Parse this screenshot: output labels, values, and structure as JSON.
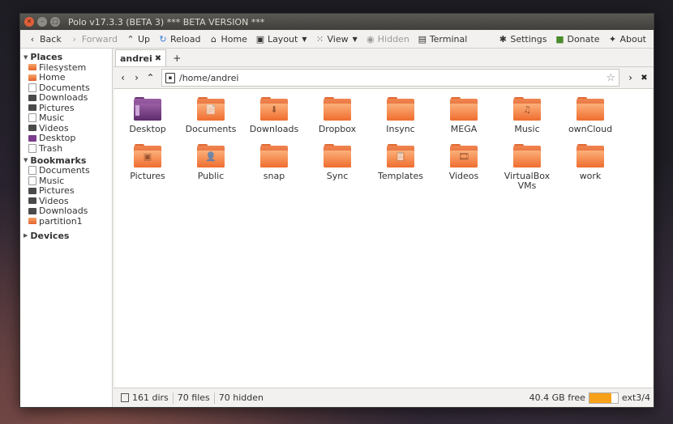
{
  "window": {
    "title": "Polo v17.3.3 (BETA 3)  *** BETA VERSION ***"
  },
  "toolbar": {
    "back": "Back",
    "forward": "Forward",
    "up": "Up",
    "reload": "Reload",
    "home": "Home",
    "layout": "Layout",
    "view": "View",
    "hidden": "Hidden",
    "terminal": "Terminal",
    "settings": "Settings",
    "donate": "Donate",
    "about": "About"
  },
  "sidebar": {
    "places_title": "Places",
    "places": [
      {
        "label": "Filesystem",
        "icon": "orange"
      },
      {
        "label": "Home",
        "icon": "orange"
      },
      {
        "label": "Documents",
        "icon": "doc"
      },
      {
        "label": "Downloads",
        "icon": "dark"
      },
      {
        "label": "Pictures",
        "icon": "dark"
      },
      {
        "label": "Music",
        "icon": "doc"
      },
      {
        "label": "Videos",
        "icon": "dark"
      },
      {
        "label": "Desktop",
        "icon": "purple"
      },
      {
        "label": "Trash",
        "icon": "doc"
      }
    ],
    "bookmarks_title": "Bookmarks",
    "bookmarks": [
      {
        "label": "Documents",
        "icon": "doc"
      },
      {
        "label": "Music",
        "icon": "doc"
      },
      {
        "label": "Pictures",
        "icon": "dark"
      },
      {
        "label": "Videos",
        "icon": "dark"
      },
      {
        "label": "Downloads",
        "icon": "dark"
      },
      {
        "label": "partition1",
        "icon": "orange"
      }
    ],
    "devices_title": "Devices"
  },
  "tabs": [
    {
      "label": "andrei"
    }
  ],
  "tab_add": "+",
  "path": {
    "value": "/home/andrei"
  },
  "items": [
    {
      "label": "Desktop",
      "type": "desktop",
      "emblem": ""
    },
    {
      "label": "Documents",
      "type": "folder",
      "emblem": "📄"
    },
    {
      "label": "Downloads",
      "type": "folder",
      "emblem": "⬇"
    },
    {
      "label": "Dropbox",
      "type": "folder",
      "emblem": ""
    },
    {
      "label": "Insync",
      "type": "folder",
      "emblem": ""
    },
    {
      "label": "MEGA",
      "type": "folder",
      "emblem": ""
    },
    {
      "label": "Music",
      "type": "folder",
      "emblem": "♫"
    },
    {
      "label": "ownCloud",
      "type": "folder",
      "emblem": ""
    },
    {
      "label": "Pictures",
      "type": "folder",
      "emblem": "▣"
    },
    {
      "label": "Public",
      "type": "folder",
      "emblem": "👤"
    },
    {
      "label": "snap",
      "type": "folder",
      "emblem": ""
    },
    {
      "label": "Sync",
      "type": "folder",
      "emblem": ""
    },
    {
      "label": "Templates",
      "type": "folder",
      "emblem": "📋"
    },
    {
      "label": "Videos",
      "type": "folder",
      "emblem": "🎞"
    },
    {
      "label": "VirtualBox VMs",
      "type": "folder",
      "emblem": ""
    },
    {
      "label": "work",
      "type": "folder",
      "emblem": ""
    }
  ],
  "status": {
    "dirs": "161 dirs",
    "files": "70 files",
    "hidden": "70 hidden",
    "free": "40.4 GB  free",
    "fs": "ext3/4",
    "disk_used_fraction": 0.78,
    "disk_color": "#f7a11a"
  }
}
